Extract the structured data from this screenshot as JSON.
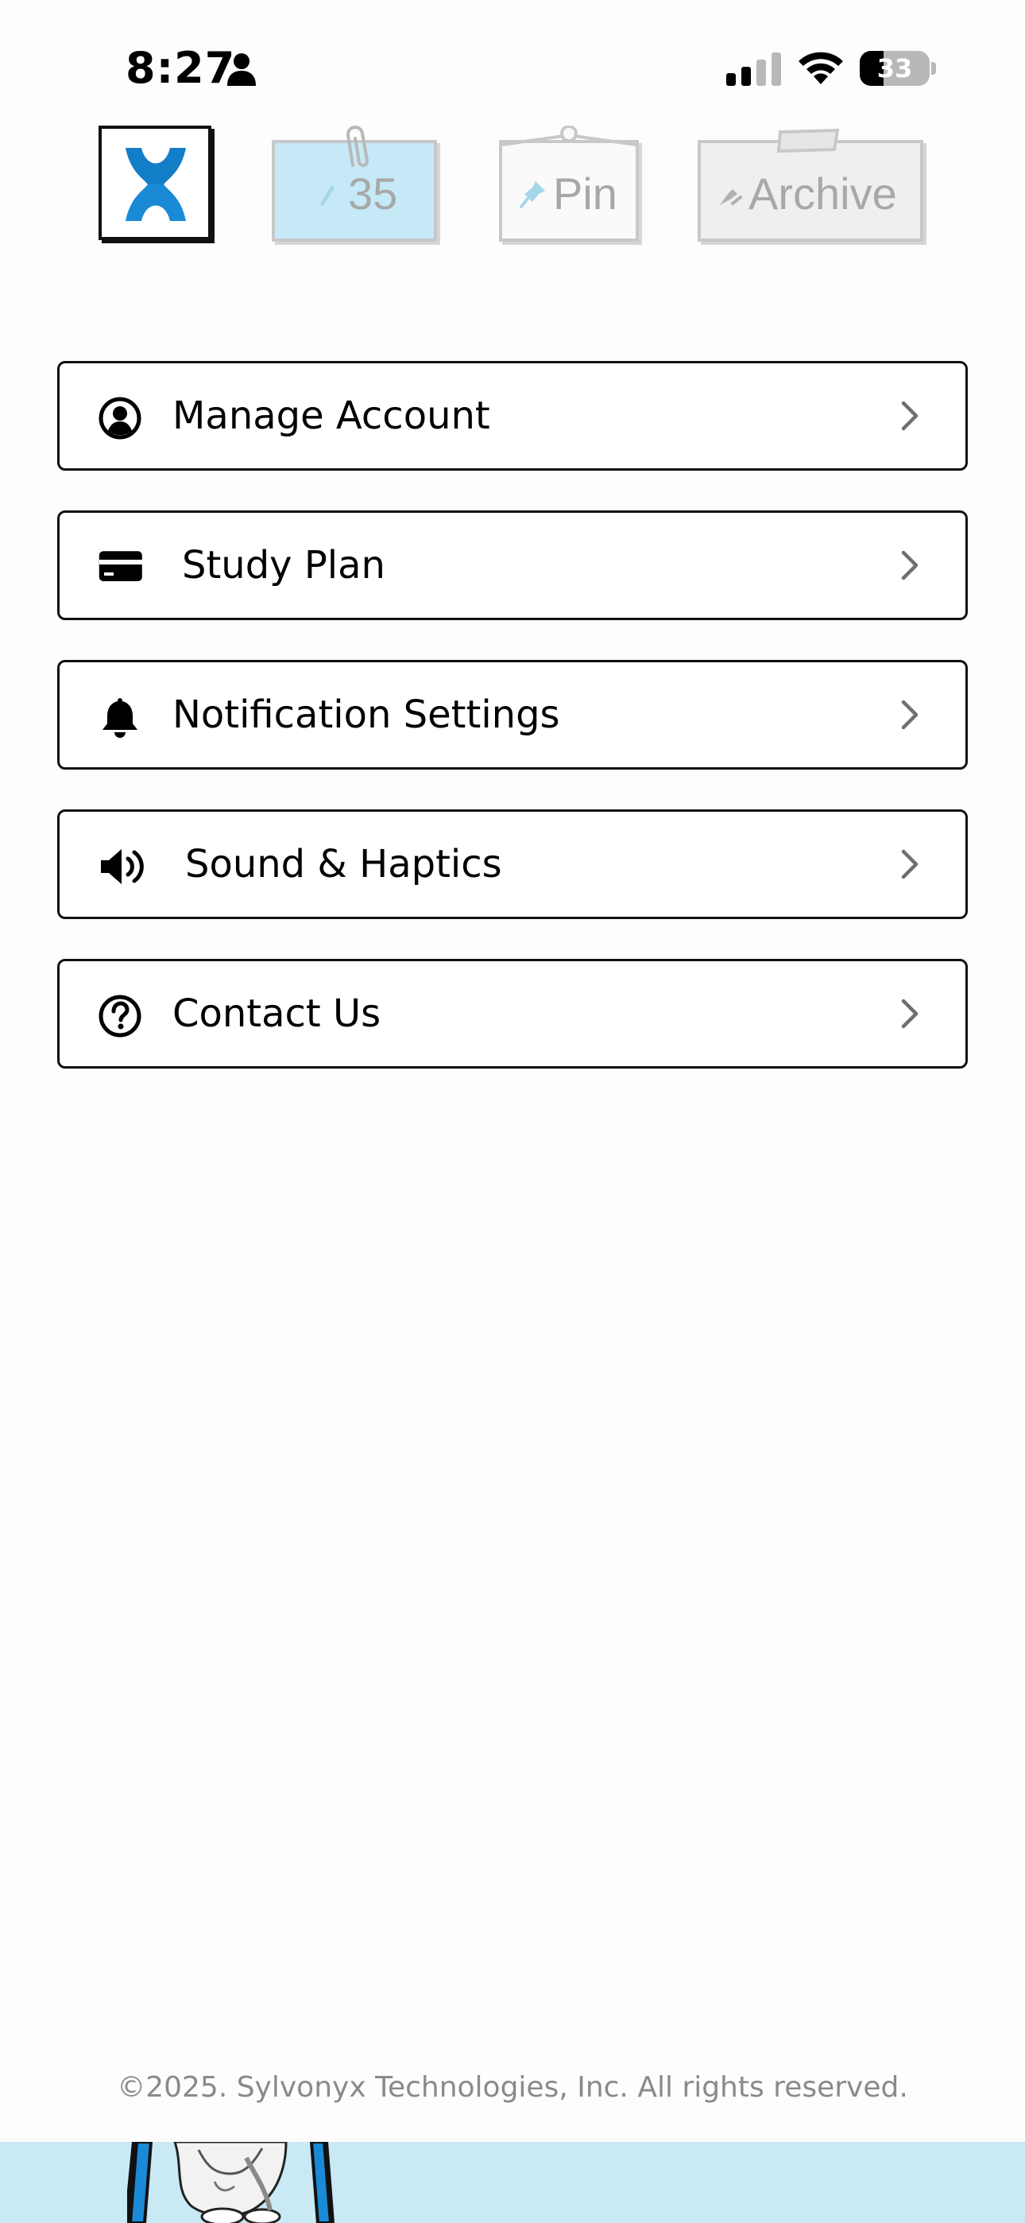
{
  "status_bar": {
    "time": "8:27",
    "battery_level": "33"
  },
  "top_tabs": {
    "logo_letter": "X",
    "count_label": "35",
    "pin_label": "Pin",
    "archive_label": "Archive"
  },
  "menu": {
    "items": [
      {
        "label": "Manage Account",
        "icon": "user-circle-icon"
      },
      {
        "label": "Study Plan",
        "icon": "credit-card-icon"
      },
      {
        "label": "Notification Settings",
        "icon": "bell-icon"
      },
      {
        "label": "Sound & Haptics",
        "icon": "speaker-icon"
      },
      {
        "label": "Contact Us",
        "icon": "question-circle-icon"
      }
    ]
  },
  "footer": {
    "copyright": "©2025. Sylvonyx Technologies, Inc. All rights reserved."
  },
  "colors": {
    "accent_blue": "#1a8ad6",
    "tab_blue": "#c5e9f7",
    "band_blue": "#c9e9f5",
    "text_gray": "#8a8a8a"
  }
}
